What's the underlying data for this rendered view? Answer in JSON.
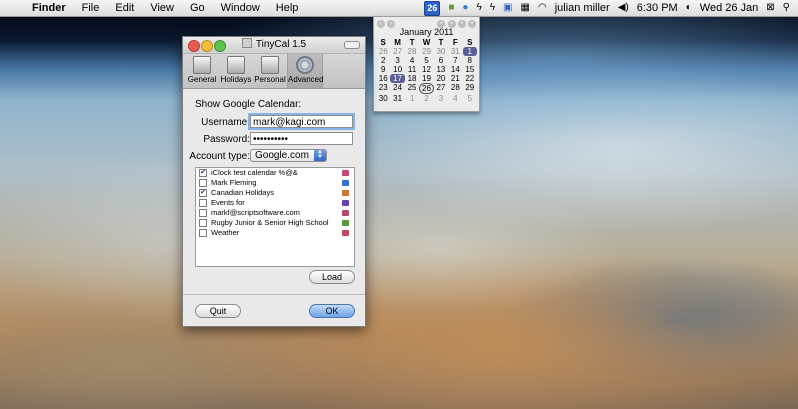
{
  "menubar": {
    "apple_icon": "apple-icon",
    "items": [
      "Finder",
      "File",
      "Edit",
      "View",
      "Go",
      "Window",
      "Help"
    ],
    "tray": {
      "calendar_badge": "26",
      "user": "julian miller",
      "time": "6:30 PM",
      "date": "Wed 26 Jan"
    }
  },
  "calendar_popup": {
    "month_title": "January 2011",
    "day_headers": [
      "S",
      "M",
      "T",
      "W",
      "T",
      "F",
      "S"
    ],
    "weeks": [
      [
        "26",
        "27",
        "28",
        "29",
        "30",
        "31",
        "1"
      ],
      [
        "2",
        "3",
        "4",
        "5",
        "6",
        "7",
        "8"
      ],
      [
        "9",
        "10",
        "11",
        "12",
        "13",
        "14",
        "15"
      ],
      [
        "16",
        "17",
        "18",
        "19",
        "20",
        "21",
        "22"
      ],
      [
        "23",
        "24",
        "25",
        "26",
        "27",
        "28",
        "29"
      ],
      [
        "30",
        "31",
        "1",
        "2",
        "3",
        "4",
        "5"
      ]
    ]
  },
  "window": {
    "title": "TinyCal 1.5",
    "toolbar": [
      {
        "label": "General",
        "icon": "switch-icon"
      },
      {
        "label": "Holidays",
        "icon": "flag-icon"
      },
      {
        "label": "Personal",
        "icon": "person-icon"
      },
      {
        "label": "Advanced",
        "icon": "gear-icon"
      }
    ],
    "section_title": "Show Google Calendar:",
    "username_label": "Username:",
    "username_value": "mark@kagi.com",
    "password_label": "Password:",
    "password_value": "••••••••••",
    "account_type_label": "Account type:",
    "account_type_value": "Google.com",
    "calendars": [
      {
        "name": "iClock test calendar %@&",
        "checked": true,
        "color": "#c2477a"
      },
      {
        "name": "Mark Fleming",
        "checked": false,
        "color": "#3a6ed6"
      },
      {
        "name": "Canadian Holidays",
        "checked": true,
        "color": "#d0762c"
      },
      {
        "name": "Events for",
        "checked": false,
        "color": "#6a3fb0"
      },
      {
        "name": "markf@scriptsoftware.com",
        "checked": false,
        "color": "#b04a6c"
      },
      {
        "name": "Rugby Junior & Senior High School",
        "checked": false,
        "color": "#5a9a3a"
      },
      {
        "name": "Weather",
        "checked": false,
        "color": "#c04a66"
      }
    ],
    "load_label": "Load",
    "quit_label": "Quit",
    "ok_label": "OK"
  }
}
